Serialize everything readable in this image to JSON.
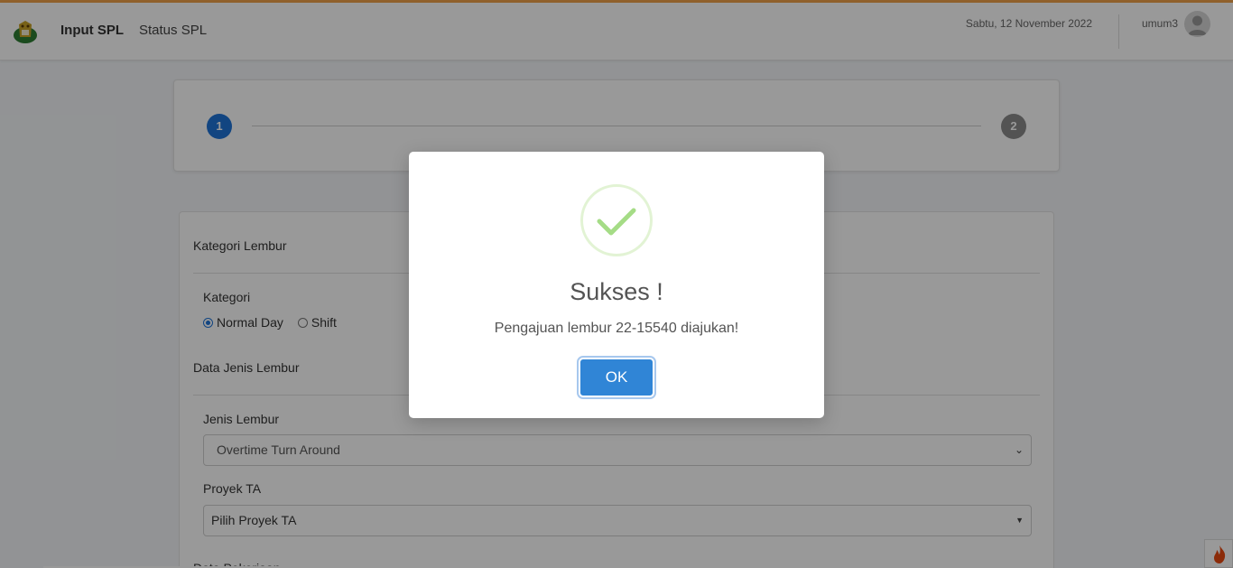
{
  "navbar": {
    "logo": "garuda-logo",
    "links": [
      {
        "label": "Input SPL",
        "active": true
      },
      {
        "label": "Status SPL",
        "active": false
      }
    ],
    "date": "Sabtu, 12 November 2022",
    "username": "umum3",
    "avatar_icon": "user-avatar-icon"
  },
  "stepper": {
    "steps": [
      "1",
      "2"
    ],
    "active_step": "1",
    "active_color": "#1e73d8",
    "inactive_color": "#8a8a8a"
  },
  "form": {
    "section_kategori_lembur": "Kategori Lembur",
    "kategori_label": "Kategori",
    "kategori_options": [
      {
        "label": "Normal Day",
        "checked": true
      },
      {
        "label": "Shift",
        "checked": false
      }
    ],
    "section_data_jenis": "Data Jenis Lembur",
    "jenis_lembur_label": "Jenis Lembur",
    "jenis_lembur_value": "Overtime Turn Around",
    "proyek_ta_label": "Proyek TA",
    "proyek_ta_value": "Pilih Proyek TA",
    "section_data_pekerjaan": "Data Pekerjaan"
  },
  "modal": {
    "icon": "success-check-icon",
    "title": "Sukses !",
    "message": "Pengajuan lembur 22-15540 diajukan!",
    "ok_label": "OK",
    "button_color": "#3085d6",
    "check_color": "#a5dc86"
  },
  "corner_icon": "flame-icon"
}
